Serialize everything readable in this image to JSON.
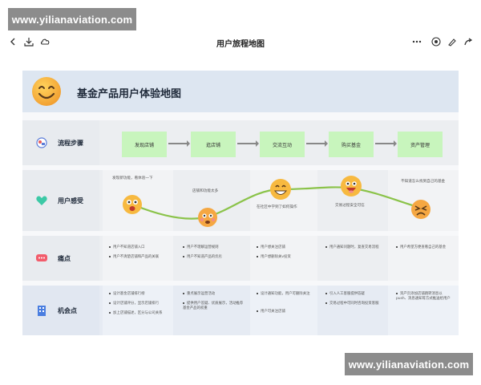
{
  "watermarks": {
    "top": "www.yilianaviation.com",
    "bottom": "www.yilianaviation.com"
  },
  "toolbar": {
    "title": "用户旅程地图"
  },
  "board": {
    "title": "基金产品用户体验地图",
    "rows": {
      "steps": {
        "label": "流程步骤",
        "items": [
          "发现店铺",
          "逛店铺",
          "交流互动",
          "购买基金",
          "资产管理"
        ]
      },
      "feelings": {
        "label": "用户感受",
        "items": [
          "发现新功能，看体验一下",
          "店铺和功能太多",
          "在社区中学到了如何操作",
          "交易过程安全可信",
          "不知道怎么找到自己的基金"
        ]
      },
      "pain_points": {
        "label": "痛点",
        "columns": [
          [
            "用户不知道店铺入口",
            "用户不清楚店铺和产品的关联"
          ],
          [
            "用户不理解运营规则",
            "用户不知道产品的优劣"
          ],
          [
            "用户想关注店铺",
            "用户想删除关v投资"
          ],
          [
            "用户通知问题时，复查交易流程"
          ],
          [
            "用户希望方便查看自己的基金"
          ]
        ]
      },
      "opportunities": {
        "label": "机会点",
        "columns": [
          [
            "设计基金店铺排行榜",
            "设计店铺评分，显示店铺排行",
            "加上店铺描述，区分与公司关系"
          ],
          [
            "重点展示运营活动",
            "提供用户答疑、优质展示，活动推荐基金产品的权重"
          ],
          [
            "设计通知功能，用户可删除关注",
            "用户可关注店铺"
          ],
          [
            "引入人工客服提供答疑",
            "交易过程中可同时咨询投资客服"
          ],
          [
            "资产页添加店铺跳转消息以push、消息通知等方式推送给用户"
          ]
        ]
      }
    }
  },
  "colors": {
    "accent_green": "#c8f5bd",
    "curve": "#8bc34a",
    "header": "#dde6f1"
  },
  "icons": [
    "back-icon",
    "download-icon",
    "cloud-icon",
    "more-icon",
    "record-icon",
    "brush-icon",
    "share-icon"
  ]
}
